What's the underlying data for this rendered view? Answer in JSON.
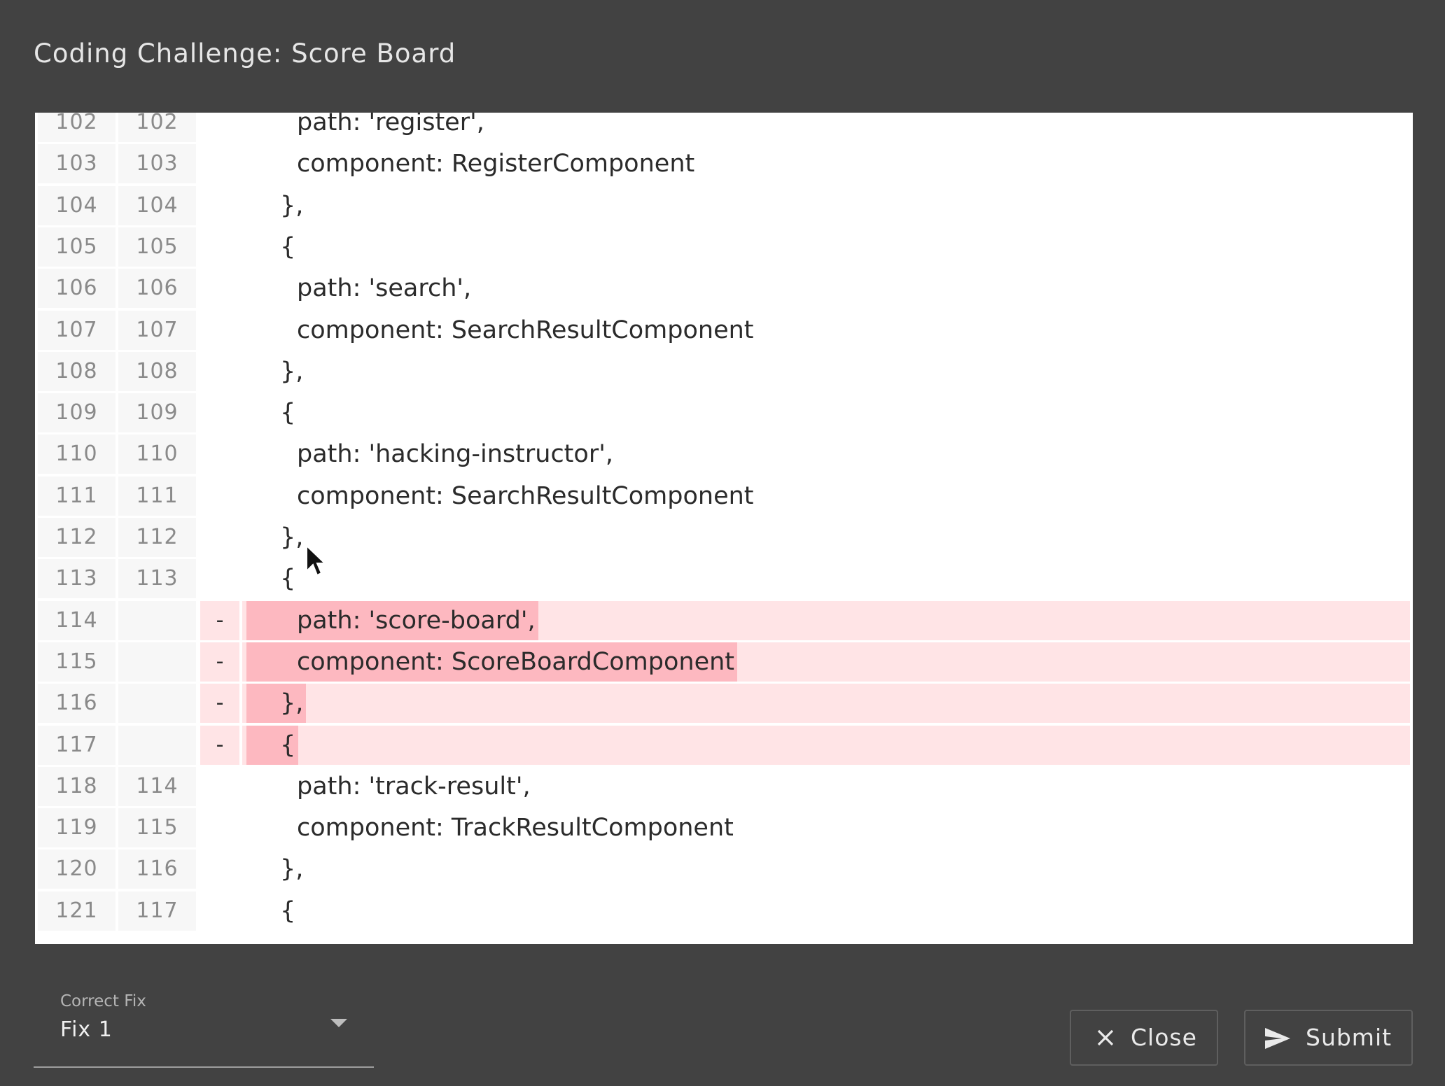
{
  "dialog": {
    "title": "Coding Challenge: Score Board"
  },
  "diff": {
    "lines": [
      {
        "old": "102",
        "new": "102",
        "marker": "",
        "type": "context",
        "code": "    path: 'register',"
      },
      {
        "old": "103",
        "new": "103",
        "marker": "",
        "type": "context",
        "code": "    component: RegisterComponent"
      },
      {
        "old": "104",
        "new": "104",
        "marker": "",
        "type": "context",
        "code": "  },"
      },
      {
        "old": "105",
        "new": "105",
        "marker": "",
        "type": "context",
        "code": "  {"
      },
      {
        "old": "106",
        "new": "106",
        "marker": "",
        "type": "context",
        "code": "    path: 'search',"
      },
      {
        "old": "107",
        "new": "107",
        "marker": "",
        "type": "context",
        "code": "    component: SearchResultComponent"
      },
      {
        "old": "108",
        "new": "108",
        "marker": "",
        "type": "context",
        "code": "  },"
      },
      {
        "old": "109",
        "new": "109",
        "marker": "",
        "type": "context",
        "code": "  {"
      },
      {
        "old": "110",
        "new": "110",
        "marker": "",
        "type": "context",
        "code": "    path: 'hacking-instructor',"
      },
      {
        "old": "111",
        "new": "111",
        "marker": "",
        "type": "context",
        "code": "    component: SearchResultComponent"
      },
      {
        "old": "112",
        "new": "112",
        "marker": "",
        "type": "context",
        "code": "  },"
      },
      {
        "old": "113",
        "new": "113",
        "marker": "",
        "type": "context",
        "code": "  {"
      },
      {
        "old": "114",
        "new": "",
        "marker": "-",
        "type": "removed",
        "code": "    path: 'score-board',"
      },
      {
        "old": "115",
        "new": "",
        "marker": "-",
        "type": "removed",
        "code": "    component: ScoreBoardComponent"
      },
      {
        "old": "116",
        "new": "",
        "marker": "-",
        "type": "removed",
        "code": "  },"
      },
      {
        "old": "117",
        "new": "",
        "marker": "-",
        "type": "removed",
        "code": "  {"
      },
      {
        "old": "118",
        "new": "114",
        "marker": "",
        "type": "context",
        "code": "    path: 'track-result',"
      },
      {
        "old": "119",
        "new": "115",
        "marker": "",
        "type": "context",
        "code": "    component: TrackResultComponent"
      },
      {
        "old": "120",
        "new": "116",
        "marker": "",
        "type": "context",
        "code": "  },"
      },
      {
        "old": "121",
        "new": "117",
        "marker": "",
        "type": "context",
        "code": "  {"
      }
    ]
  },
  "footer": {
    "select_label": "Correct Fix",
    "select_value": "Fix 1",
    "close_label": "Close",
    "submit_label": "Submit",
    "close_icon": "close-icon",
    "submit_icon": "send-icon"
  },
  "colors": {
    "background": "#424242",
    "removed_line_bg": "#ffe4e6",
    "removed_text_bg": "#fdb8c0"
  }
}
